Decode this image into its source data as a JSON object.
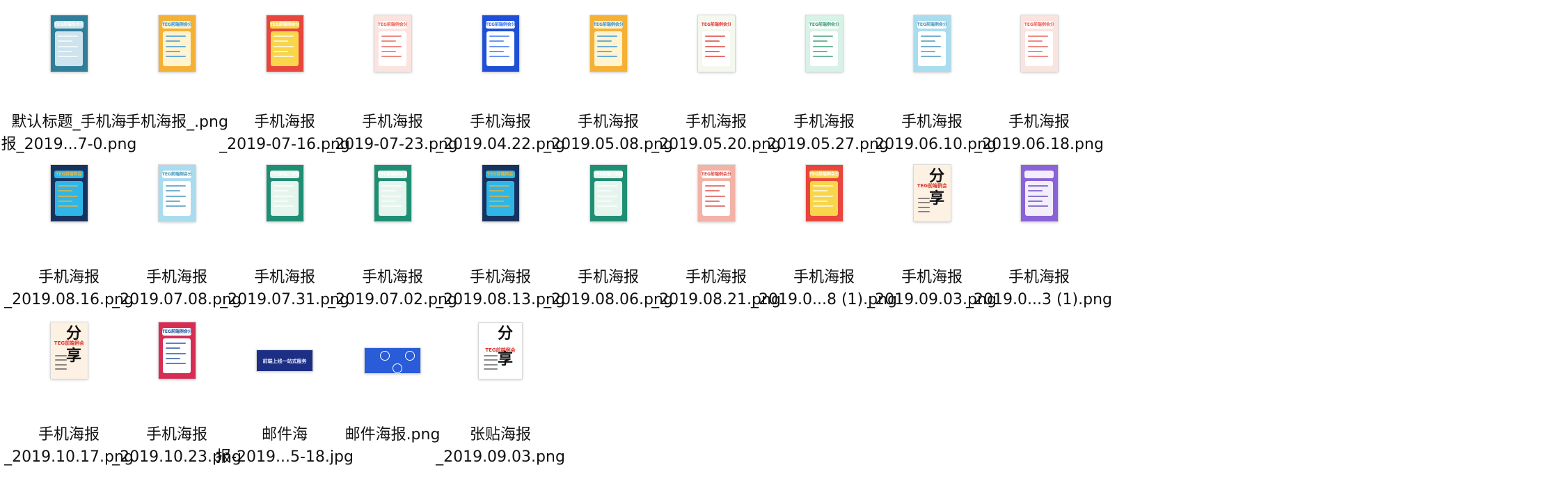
{
  "files": [
    {
      "line1": "默认标题_手机海",
      "line2": "报_2019...7-0.png",
      "style": "mountain",
      "header": "TEG前端技术分享"
    },
    {
      "line1": "手机海报_.png",
      "line2": "",
      "style": "orange",
      "header": "TEG前端例会分享"
    },
    {
      "line1": "手机海报",
      "line2": "_2019-07-16.png",
      "style": "redyellow",
      "header": "TEG前端例会分享"
    },
    {
      "line1": "手机海报",
      "line2": "_2019-07-23.png",
      "style": "pinkwhite",
      "header": "TEG前端例会分享"
    },
    {
      "line1": "手机海报",
      "line2": "_2019.04.22.png",
      "style": "blue",
      "header": "TEG前端例会分享"
    },
    {
      "line1": "手机海报",
      "line2": "_2019.05.08.png",
      "style": "orange",
      "header": "TEG前端例会分享"
    },
    {
      "line1": "手机海报",
      "line2": "_2019.05.20.png",
      "style": "greenframe",
      "header": "TEG前端例会分享"
    },
    {
      "line1": "手机海报",
      "line2": "_2019.05.27.png",
      "style": "mint",
      "header": "TEG前端例会分享"
    },
    {
      "line1": "手机海报",
      "line2": "_2019.06.10.png",
      "style": "lightblue",
      "header": "TEG前端例会分享"
    },
    {
      "line1": "手机海报",
      "line2": "_2019.06.18.png",
      "style": "pinkwhite",
      "header": "TEG前端例会分享"
    },
    {
      "line1": "手机海报",
      "line2": "_2019.08.16.png",
      "style": "navycolor",
      "header": "TEG前端例会"
    },
    {
      "line1": "手机海报",
      "line2": "_2019.07.08.png",
      "style": "lightblue",
      "header": "TEG前端例会分享"
    },
    {
      "line1": "手机海报",
      "line2": "_2019.07.31.png",
      "style": "green",
      "header": "TEG前端入职邀请"
    },
    {
      "line1": "手机海报",
      "line2": "_2019.07.02.png",
      "style": "green",
      "header": "TEG前端例会分享"
    },
    {
      "line1": "手机海报",
      "line2": "_2019.08.13.png",
      "style": "navycolor",
      "header": "TEG前端例会"
    },
    {
      "line1": "手机海报",
      "line2": "_2019.08.06.png",
      "style": "green",
      "header": "TEG前端入职邀请"
    },
    {
      "line1": "手机海报",
      "line2": "_2019.08.21.png",
      "style": "salmon",
      "header": "TEG前端例会分享"
    },
    {
      "line1": "手机海报",
      "line2": "_2019.0...8 (1).png",
      "style": "redyellow",
      "header": "TEG前端例会分享"
    },
    {
      "line1": "手机海报",
      "line2": "_2019.09.03.png",
      "style": "calli",
      "header": "TEG前端例会",
      "big1": "分",
      "big2": "享"
    },
    {
      "line1": "手机海报",
      "line2": "_2019.0...3 (1).png",
      "style": "purple",
      "header": ""
    },
    {
      "line1": "手机海报",
      "line2": "_2019.10.17.png",
      "style": "calli",
      "header": "TEG前端例会",
      "big1": "分",
      "big2": "享"
    },
    {
      "line1": "手机海报",
      "line2": "_2019.10.23.png",
      "style": "crimson",
      "header": "TEG前端例会分享"
    },
    {
      "line1": "邮件海",
      "line2": "报-2019...5-18.jpg",
      "style": "banner",
      "header": "前端上线一站式服务"
    },
    {
      "line1": "邮件海报.png",
      "line2": "",
      "style": "bluebanner",
      "header": ""
    },
    {
      "line1": "张贴海报",
      "line2": "_2019.09.03.png",
      "style": "posterwhite",
      "header": "TEG前端例会",
      "big1": "分",
      "big2": "享"
    }
  ],
  "palette": {
    "mountain": [
      "#2f7e9a",
      "#cde3ee",
      "#ffffff"
    ],
    "orange": [
      "#f4b136",
      "#fff3d0",
      "#2d8fd6"
    ],
    "redyellow": [
      "#e8453c",
      "#f8d54a",
      "#ffffff"
    ],
    "pinkwhite": [
      "#fbe3e0",
      "#ffffff",
      "#e85a4f"
    ],
    "blue": [
      "#1e4fd6",
      "#ffffff",
      "#2b6cf0"
    ],
    "greenframe": [
      "#f4f8ee",
      "#ffffff",
      "#d9342b"
    ],
    "mint": [
      "#d8f2e8",
      "#ffffff",
      "#2f9a6f"
    ],
    "lightblue": [
      "#a9dcef",
      "#ffffff",
      "#3a8fb8"
    ],
    "navycolor": [
      "#17325e",
      "#2fb6e8",
      "#f1b43a"
    ],
    "green": [
      "#1f8f74",
      "#e5f5ee",
      "#ffffff"
    ],
    "salmon": [
      "#f3b2a6",
      "#ffffff",
      "#d9453c"
    ],
    "calli": [
      "#fdf1e3",
      "#ffffff",
      "#d9342b"
    ],
    "purple": [
      "#8a63d8",
      "#f3eefc",
      "#5b3fb8"
    ],
    "crimson": [
      "#d62d55",
      "#ffffff",
      "#1b4aa0"
    ],
    "banner": [
      "#1c2f84",
      "#ffffff",
      "#e6e9ff"
    ],
    "bluebanner": [
      "#2a5bd8",
      "#ffffff",
      "#6f9bf2"
    ],
    "posterwhite": [
      "#ffffff",
      "#ffffff",
      "#d9342b"
    ]
  }
}
